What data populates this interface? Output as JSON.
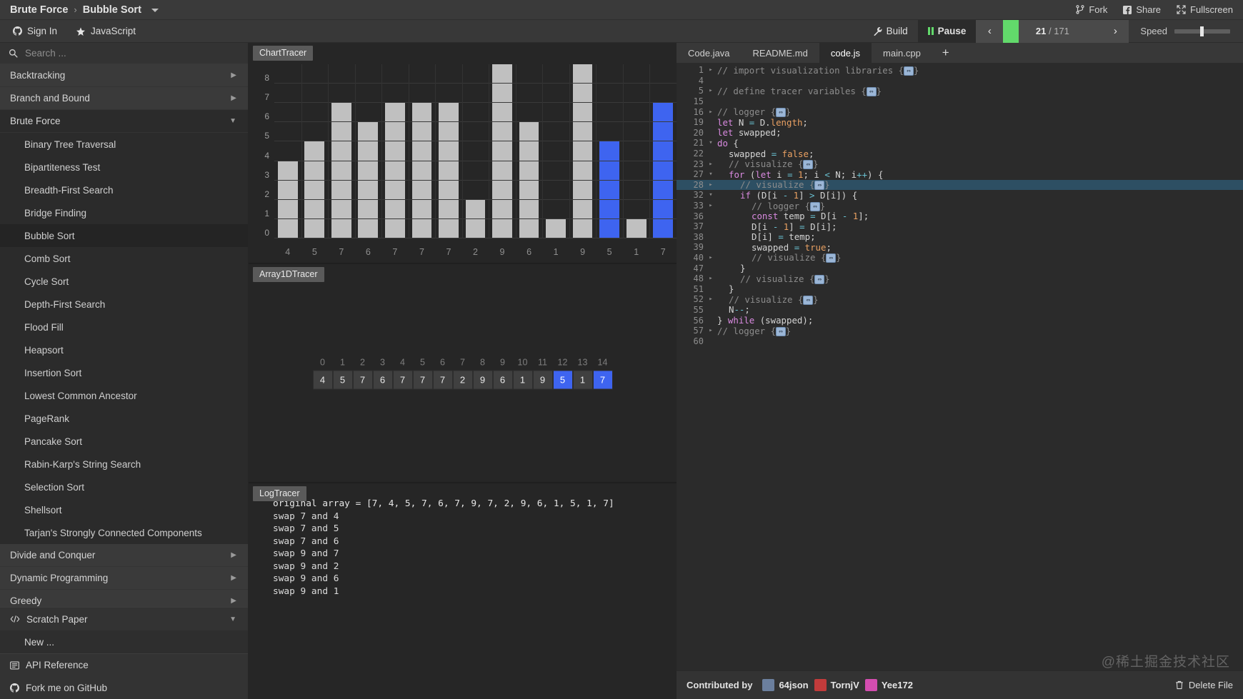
{
  "topbar": {
    "breadcrumb": [
      "Brute Force",
      "Bubble Sort"
    ],
    "separator": "›",
    "fork": "Fork",
    "share": "Share",
    "fullscreen": "Fullscreen"
  },
  "secondbar": {
    "sign_in": "Sign In",
    "language": "JavaScript",
    "build": "Build",
    "pause": "Pause",
    "prev": "‹",
    "next": "›",
    "progress_current": "21",
    "progress_sep": " / ",
    "progress_total": "171",
    "progress_percent": 16,
    "speed_label": "Speed",
    "speed_value": 46
  },
  "sidebar": {
    "search_placeholder": "Search ...",
    "categories": [
      {
        "label": "Backtracking",
        "state": "collapsed"
      },
      {
        "label": "Branch and Bound",
        "state": "collapsed"
      },
      {
        "label": "Brute Force",
        "state": "expanded"
      }
    ],
    "brute_force_items": [
      "Binary Tree Traversal",
      "Bipartiteness Test",
      "Breadth-First Search",
      "Bridge Finding",
      "Bubble Sort",
      "Comb Sort",
      "Cycle Sort",
      "Depth-First Search",
      "Flood Fill",
      "Heapsort",
      "Insertion Sort",
      "Lowest Common Ancestor",
      "PageRank",
      "Pancake Sort",
      "Rabin-Karp's String Search",
      "Selection Sort",
      "Shellsort",
      "Tarjan's Strongly Connected Components"
    ],
    "active_item": "Bubble Sort",
    "categories_after": [
      {
        "label": "Divide and Conquer",
        "state": "collapsed"
      },
      {
        "label": "Dynamic Programming",
        "state": "collapsed"
      },
      {
        "label": "Greedy",
        "state": "collapsed"
      }
    ],
    "scratch_paper": "Scratch Paper",
    "scratch_new": "New ...",
    "api_reference": "API Reference",
    "fork_github": "Fork me on GitHub"
  },
  "visualizer": {
    "chart_title": "ChartTracer",
    "array_title": "Array1DTracer",
    "log_title": "LogTracer",
    "array_indices": [
      "0",
      "1",
      "2",
      "3",
      "4",
      "5",
      "6",
      "7",
      "8",
      "9",
      "10",
      "11",
      "12",
      "13",
      "14"
    ],
    "array_values": [
      "4",
      "5",
      "7",
      "6",
      "7",
      "7",
      "7",
      "2",
      "9",
      "6",
      "1",
      "9",
      "5",
      "1",
      "7"
    ],
    "array_selected": [
      12,
      14
    ],
    "log_lines": [
      "original array = [7, 4, 5, 7, 6, 7, 9, 7, 2, 9, 6, 1, 5, 1, 7]",
      "swap 7 and 4",
      "swap 7 and 5",
      "swap 7 and 6",
      "swap 9 and 7",
      "swap 9 and 2",
      "swap 9 and 6",
      "swap 9 and 1"
    ]
  },
  "chart_data": {
    "type": "bar",
    "title": "ChartTracer",
    "categories": [
      "4",
      "5",
      "7",
      "6",
      "7",
      "7",
      "7",
      "2",
      "9",
      "6",
      "1",
      "9",
      "5",
      "1",
      "7"
    ],
    "values": [
      4,
      5,
      7,
      6,
      7,
      7,
      7,
      2,
      9,
      6,
      1,
      9,
      5,
      1,
      7
    ],
    "highlighted_indices": [
      12,
      14
    ],
    "bar_color": "#c0c0c0",
    "highlight_color": "#3e64f0",
    "xlabel": "",
    "ylabel": "",
    "ylim": [
      0,
      9
    ],
    "yticks": [
      0,
      1,
      2,
      3,
      4,
      5,
      6,
      7,
      8
    ],
    "grid": true,
    "legend": "none"
  },
  "editor": {
    "tabs": [
      "Code.java",
      "README.md",
      "code.js",
      "main.cpp"
    ],
    "active_tab": "code.js",
    "add_tab": "+",
    "highlighted_line": 28,
    "lines": [
      {
        "n": "1",
        "fold": "▸",
        "indent": 0,
        "tokens": [
          {
            "t": "// import visualization libraries {",
            "c": "cm"
          },
          {
            "t": "W",
            "c": "widget"
          },
          {
            "t": "}",
            "c": "cm"
          }
        ]
      },
      {
        "n": "4",
        "fold": "",
        "indent": 0,
        "tokens": []
      },
      {
        "n": "5",
        "fold": "▸",
        "indent": 0,
        "tokens": [
          {
            "t": "// define tracer variables {",
            "c": "cm"
          },
          {
            "t": "W",
            "c": "widget"
          },
          {
            "t": "}",
            "c": "cm"
          }
        ]
      },
      {
        "n": "15",
        "fold": "",
        "indent": 0,
        "tokens": []
      },
      {
        "n": "16",
        "fold": "▸",
        "indent": 0,
        "tokens": [
          {
            "t": "// logger {",
            "c": "cm"
          },
          {
            "t": "W",
            "c": "widget"
          },
          {
            "t": "}",
            "c": "cm"
          }
        ]
      },
      {
        "n": "19",
        "fold": "",
        "indent": 0,
        "tokens": [
          {
            "t": "let",
            "c": "kw"
          },
          {
            "t": " N ",
            "c": "id"
          },
          {
            "t": "=",
            "c": "op"
          },
          {
            "t": " D.",
            "c": "id"
          },
          {
            "t": "length",
            "c": "prop"
          },
          {
            "t": ";",
            "c": "id"
          }
        ]
      },
      {
        "n": "20",
        "fold": "",
        "indent": 0,
        "tokens": [
          {
            "t": "let",
            "c": "kw"
          },
          {
            "t": " swapped;",
            "c": "id"
          }
        ]
      },
      {
        "n": "21",
        "fold": "▾",
        "indent": 0,
        "tokens": [
          {
            "t": "do",
            "c": "kw"
          },
          {
            "t": " {",
            "c": "id"
          }
        ]
      },
      {
        "n": "22",
        "fold": "",
        "indent": 1,
        "tokens": [
          {
            "t": "swapped ",
            "c": "id"
          },
          {
            "t": "=",
            "c": "op"
          },
          {
            "t": " ",
            "c": "id"
          },
          {
            "t": "false",
            "c": "lit"
          },
          {
            "t": ";",
            "c": "id"
          }
        ]
      },
      {
        "n": "23",
        "fold": "▸",
        "indent": 1,
        "tokens": [
          {
            "t": "// visualize {",
            "c": "cm"
          },
          {
            "t": "W",
            "c": "widget"
          },
          {
            "t": "}",
            "c": "cm"
          }
        ]
      },
      {
        "n": "27",
        "fold": "▾",
        "indent": 1,
        "tokens": [
          {
            "t": "for",
            "c": "kw"
          },
          {
            "t": " (",
            "c": "id"
          },
          {
            "t": "let",
            "c": "kw"
          },
          {
            "t": " i ",
            "c": "id"
          },
          {
            "t": "=",
            "c": "op"
          },
          {
            "t": " ",
            "c": "id"
          },
          {
            "t": "1",
            "c": "num"
          },
          {
            "t": "; i ",
            "c": "id"
          },
          {
            "t": "<",
            "c": "op"
          },
          {
            "t": " N; i",
            "c": "id"
          },
          {
            "t": "++",
            "c": "op"
          },
          {
            "t": ") {",
            "c": "id"
          }
        ]
      },
      {
        "n": "28",
        "fold": "▸",
        "indent": 2,
        "tokens": [
          {
            "t": "// visualize {",
            "c": "cm"
          },
          {
            "t": "W",
            "c": "widget"
          },
          {
            "t": "}",
            "c": "cm"
          }
        ]
      },
      {
        "n": "32",
        "fold": "▾",
        "indent": 2,
        "tokens": [
          {
            "t": "if",
            "c": "kw"
          },
          {
            "t": " (D[i ",
            "c": "id"
          },
          {
            "t": "-",
            "c": "op"
          },
          {
            "t": " ",
            "c": "id"
          },
          {
            "t": "1",
            "c": "num"
          },
          {
            "t": "] ",
            "c": "id"
          },
          {
            "t": ">",
            "c": "op"
          },
          {
            "t": " D[i]) {",
            "c": "id"
          }
        ]
      },
      {
        "n": "33",
        "fold": "▸",
        "indent": 3,
        "tokens": [
          {
            "t": "// logger {",
            "c": "cm"
          },
          {
            "t": "W",
            "c": "widget"
          },
          {
            "t": "}",
            "c": "cm"
          }
        ]
      },
      {
        "n": "36",
        "fold": "",
        "indent": 3,
        "tokens": [
          {
            "t": "const",
            "c": "kw"
          },
          {
            "t": " temp ",
            "c": "id"
          },
          {
            "t": "=",
            "c": "op"
          },
          {
            "t": " D[i ",
            "c": "id"
          },
          {
            "t": "-",
            "c": "op"
          },
          {
            "t": " ",
            "c": "id"
          },
          {
            "t": "1",
            "c": "num"
          },
          {
            "t": "];",
            "c": "id"
          }
        ]
      },
      {
        "n": "37",
        "fold": "",
        "indent": 3,
        "tokens": [
          {
            "t": "D[i ",
            "c": "id"
          },
          {
            "t": "-",
            "c": "op"
          },
          {
            "t": " ",
            "c": "id"
          },
          {
            "t": "1",
            "c": "num"
          },
          {
            "t": "] ",
            "c": "id"
          },
          {
            "t": "=",
            "c": "op"
          },
          {
            "t": " D[i];",
            "c": "id"
          }
        ]
      },
      {
        "n": "38",
        "fold": "",
        "indent": 3,
        "tokens": [
          {
            "t": "D[i] ",
            "c": "id"
          },
          {
            "t": "=",
            "c": "op"
          },
          {
            "t": " temp;",
            "c": "id"
          }
        ]
      },
      {
        "n": "39",
        "fold": "",
        "indent": 3,
        "tokens": [
          {
            "t": "swapped ",
            "c": "id"
          },
          {
            "t": "=",
            "c": "op"
          },
          {
            "t": " ",
            "c": "id"
          },
          {
            "t": "true",
            "c": "lit"
          },
          {
            "t": ";",
            "c": "id"
          }
        ]
      },
      {
        "n": "40",
        "fold": "▸",
        "indent": 3,
        "tokens": [
          {
            "t": "// visualize {",
            "c": "cm"
          },
          {
            "t": "W",
            "c": "widget"
          },
          {
            "t": "}",
            "c": "cm"
          }
        ]
      },
      {
        "n": "47",
        "fold": "",
        "indent": 2,
        "tokens": [
          {
            "t": "}",
            "c": "id"
          }
        ]
      },
      {
        "n": "48",
        "fold": "▸",
        "indent": 2,
        "tokens": [
          {
            "t": "// visualize {",
            "c": "cm"
          },
          {
            "t": "W",
            "c": "widget"
          },
          {
            "t": "}",
            "c": "cm"
          }
        ]
      },
      {
        "n": "51",
        "fold": "",
        "indent": 1,
        "tokens": [
          {
            "t": "}",
            "c": "id"
          }
        ]
      },
      {
        "n": "52",
        "fold": "▸",
        "indent": 1,
        "tokens": [
          {
            "t": "// visualize {",
            "c": "cm"
          },
          {
            "t": "W",
            "c": "widget"
          },
          {
            "t": "}",
            "c": "cm"
          }
        ]
      },
      {
        "n": "55",
        "fold": "",
        "indent": 1,
        "tokens": [
          {
            "t": "N",
            "c": "id"
          },
          {
            "t": "--",
            "c": "op"
          },
          {
            "t": ";",
            "c": "id"
          }
        ]
      },
      {
        "n": "56",
        "fold": "",
        "indent": 0,
        "tokens": [
          {
            "t": "} ",
            "c": "id"
          },
          {
            "t": "while",
            "c": "kw"
          },
          {
            "t": " (swapped);",
            "c": "id"
          }
        ]
      },
      {
        "n": "57",
        "fold": "▸",
        "indent": 0,
        "tokens": [
          {
            "t": "// logger {",
            "c": "cm"
          },
          {
            "t": "W",
            "c": "widget"
          },
          {
            "t": "}",
            "c": "cm"
          }
        ]
      },
      {
        "n": "60",
        "fold": "",
        "indent": 0,
        "tokens": []
      }
    ]
  },
  "footer": {
    "contributed_by": "Contributed by",
    "contributors": [
      {
        "name": "64json",
        "color": "#6b7f9e"
      },
      {
        "name": "TornjV",
        "color": "#c23b3b"
      },
      {
        "name": "Yee172",
        "color": "#d44db0"
      }
    ],
    "delete_file": "Delete File",
    "watermark": "@稀土掘金技术社区"
  }
}
